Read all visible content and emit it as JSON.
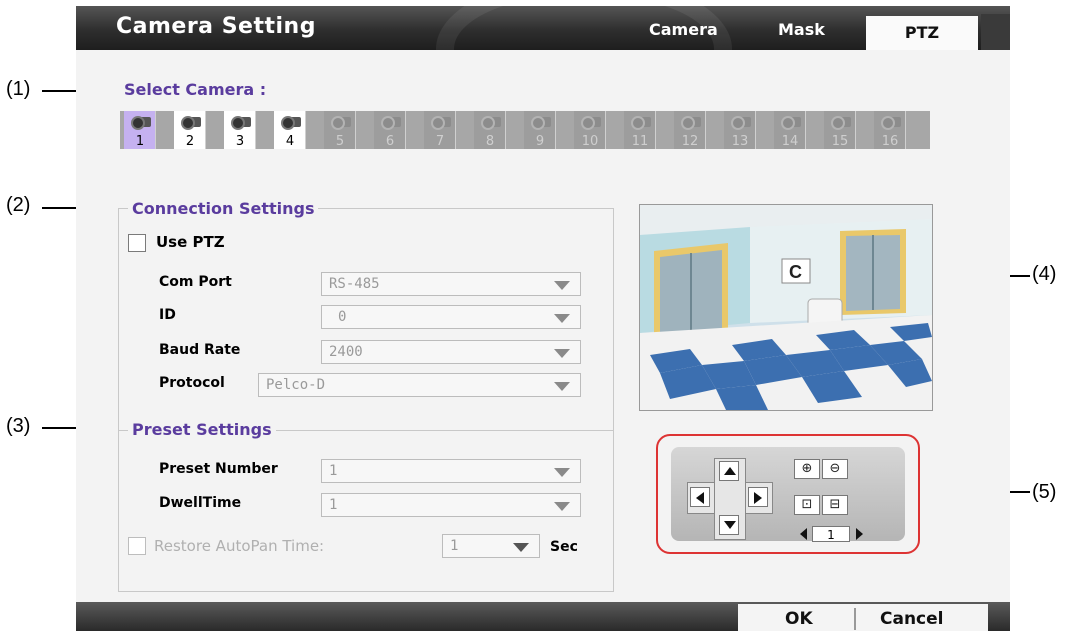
{
  "callouts": {
    "c1": "(1)",
    "c2": "(2)",
    "c3": "(3)",
    "c4": "(4)",
    "c5": "(5)"
  },
  "window": {
    "title": "Camera Setting",
    "tabs": [
      {
        "label": "Camera"
      },
      {
        "label": "Mask"
      },
      {
        "label": "PTZ",
        "active": true
      }
    ]
  },
  "select_camera": {
    "label": "Select Camera :",
    "cameras": [
      "1",
      "2",
      "3",
      "4",
      "5",
      "6",
      "7",
      "8",
      "9",
      "10",
      "11",
      "12",
      "13",
      "14",
      "15",
      "16"
    ],
    "selected": "1",
    "available_count_note": "1-4 active"
  },
  "connection": {
    "label": "Connection Settings",
    "use_ptz_label": "Use PTZ",
    "use_ptz_checked": false,
    "com_port_label": "Com Port",
    "com_port_value": "RS-485",
    "id_label": "ID",
    "id_value": "0",
    "baud_rate_label": "Baud Rate",
    "baud_rate_value": "2400",
    "protocol_label": "Protocol",
    "protocol_value": "Pelco-D"
  },
  "preset": {
    "label": "Preset Settings",
    "preset_number_label": "Preset Number",
    "preset_number_value": "1",
    "dwell_time_label": "DwellTime",
    "dwell_time_value": "1",
    "restore_label": "Restore AutoPan Time:",
    "restore_value": "1",
    "restore_unit": "Sec"
  },
  "ptz_control": {
    "speed_value": "1"
  },
  "buttons": {
    "ok": "OK",
    "cancel": "Cancel"
  },
  "colors": {
    "section_label": "#5a3c9e",
    "selected_camera": "#c5b1f0",
    "highlight_ring": "#dd3333"
  }
}
